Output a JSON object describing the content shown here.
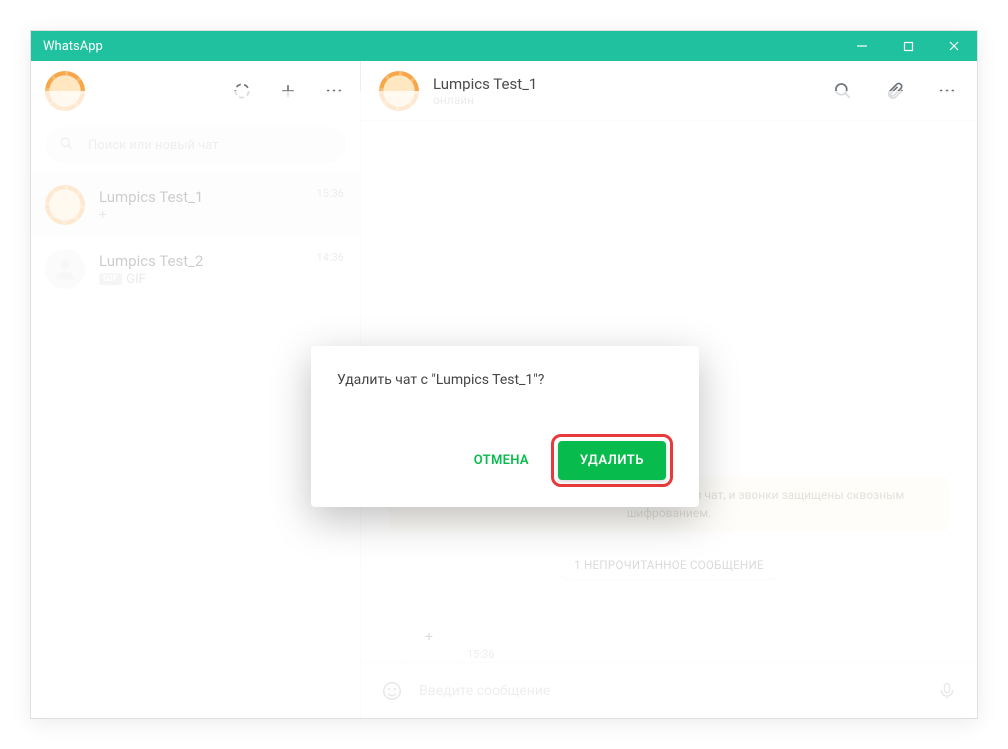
{
  "window": {
    "title": "WhatsApp"
  },
  "search": {
    "placeholder": "Поиск или новый чат"
  },
  "chats": [
    {
      "name": "Lumpics Test_1",
      "preview": "+",
      "time": "15:36",
      "selected": true,
      "avatar": "orange"
    },
    {
      "name": "Lumpics Test_2",
      "preview": "GIF",
      "time": "14:36",
      "selected": false,
      "avatar": "gray",
      "gif": true
    }
  ],
  "active_chat": {
    "name": "Lumpics Test_1",
    "status": "онлайн",
    "encryption_notice": "Сообщения, которые вы отправляете в данный чат, и звонки защищены сквозным шифрованием.",
    "unread_label": "1 НЕПРОЧИТАННОЕ СООБЩЕНИЕ",
    "incoming_message": {
      "text": "+",
      "time": "15:36"
    }
  },
  "composer": {
    "placeholder": "Введите сообщение"
  },
  "dialog": {
    "message": "Удалить чат с \"Lumpics Test_1\"?",
    "cancel": "ОТМЕНА",
    "confirm": "УДАЛИТЬ"
  },
  "colors": {
    "accent": "#20c19e",
    "primary_green": "#07bc4c",
    "highlight_red": "#e83a3a"
  }
}
